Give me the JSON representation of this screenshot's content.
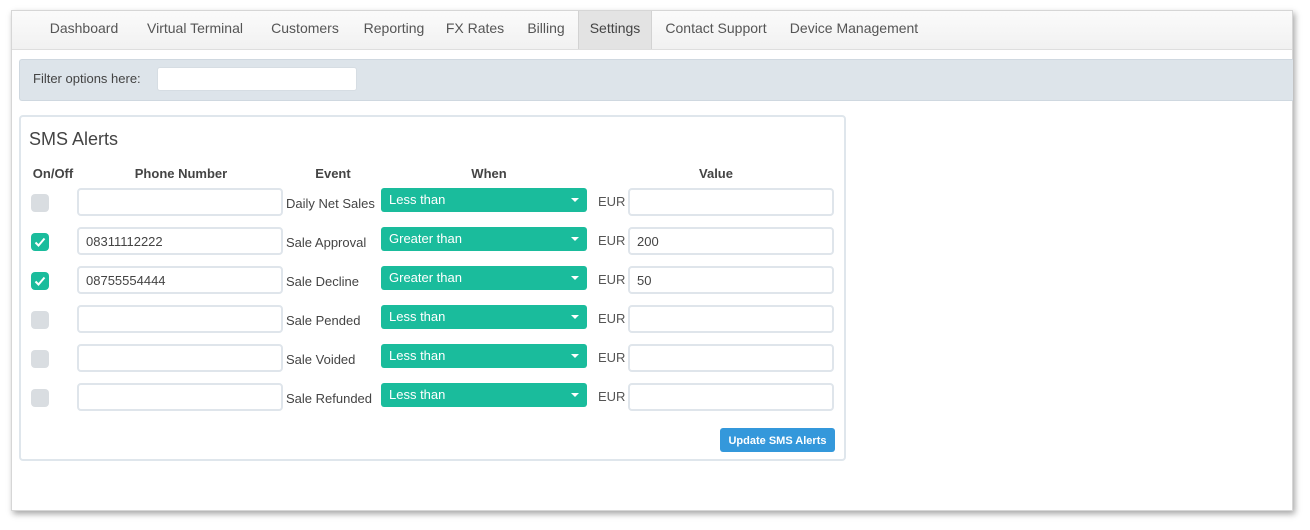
{
  "nav": {
    "items": [
      {
        "label": "Dashboard"
      },
      {
        "label": "Virtual Terminal"
      },
      {
        "label": "Customers"
      },
      {
        "label": "Reporting"
      },
      {
        "label": "FX Rates"
      },
      {
        "label": "Billing"
      },
      {
        "label": "Settings"
      },
      {
        "label": "Contact Support"
      },
      {
        "label": "Device Management"
      }
    ],
    "active": "Settings"
  },
  "filter": {
    "label": "Filter options here:",
    "value": ""
  },
  "sms_alerts": {
    "title": "SMS Alerts",
    "columns": {
      "on_off": "On/Off",
      "phone": "Phone Number",
      "event": "Event",
      "when": "When",
      "value": "Value"
    },
    "rows": [
      {
        "on": false,
        "phone": "",
        "event": "Daily Net Sales",
        "when": "Less than",
        "currency": "EUR",
        "value": ""
      },
      {
        "on": true,
        "phone": "08311112222",
        "event": "Sale Approval",
        "when": "Greater than",
        "currency": "EUR",
        "value": "200"
      },
      {
        "on": true,
        "phone": "08755554444",
        "event": "Sale Decline",
        "when": "Greater than",
        "currency": "EUR",
        "value": "50"
      },
      {
        "on": false,
        "phone": "",
        "event": "Sale Pended",
        "when": "Less than",
        "currency": "EUR",
        "value": ""
      },
      {
        "on": false,
        "phone": "",
        "event": "Sale Voided",
        "when": "Less than",
        "currency": "EUR",
        "value": ""
      },
      {
        "on": false,
        "phone": "",
        "event": "Sale Refunded",
        "when": "Less than",
        "currency": "EUR",
        "value": ""
      }
    ],
    "update_label": "Update SMS Alerts"
  },
  "colors": {
    "accent": "#1abc9c",
    "button": "#3498db",
    "filter_bg": "#dde4ea"
  }
}
